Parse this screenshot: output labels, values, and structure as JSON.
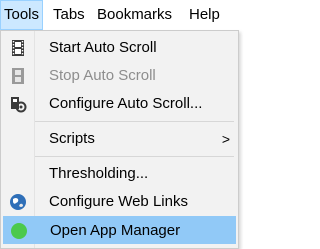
{
  "menubar": {
    "items": [
      {
        "label": "Tools"
      },
      {
        "label": "Tabs"
      },
      {
        "label": "Bookmarks"
      },
      {
        "label": "Help"
      }
    ]
  },
  "tools_menu": {
    "items": [
      {
        "label": "Start Auto Scroll",
        "icon": "film-icon",
        "enabled": true
      },
      {
        "label": "Stop Auto Scroll",
        "icon": "film-icon",
        "enabled": false
      },
      {
        "label": "Configure Auto Scroll...",
        "icon": "gear-icon",
        "enabled": true
      },
      {
        "label": "Scripts",
        "submenu_arrow": ">"
      },
      {
        "label": "Thresholding...",
        "enabled": true
      },
      {
        "label": "Configure Web Links",
        "icon": "globe-icon",
        "enabled": true
      },
      {
        "label": "Open App Manager",
        "icon": "green-dot-icon",
        "enabled": true,
        "highlighted": true
      }
    ]
  },
  "colors": {
    "menu_bg": "#f2f2f2",
    "highlight": "#91c9f7",
    "active_menu": "#cce8ff",
    "disabled_text": "#8d8d8d",
    "green_dot": "#4cc94c"
  }
}
